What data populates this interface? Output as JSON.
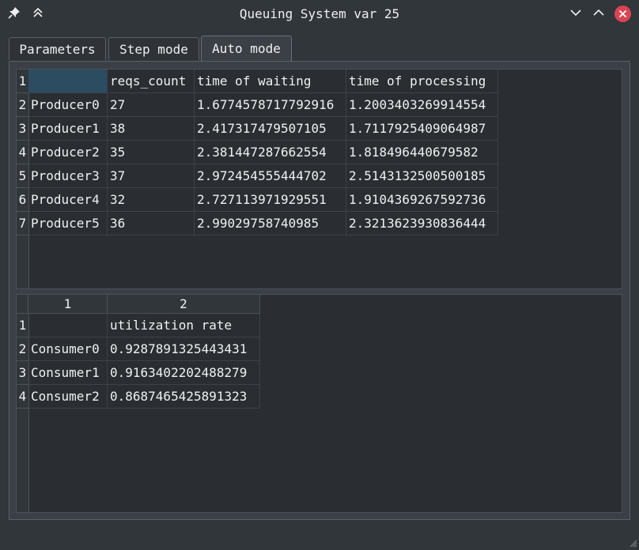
{
  "window": {
    "title": "Queuing System var 25",
    "pin_icon": "pin-icon",
    "keep_above_icon": "double-chevron-up-icon",
    "minimize_icon": "chevron-down-icon",
    "maximize_icon": "chevron-up-icon",
    "close_icon": "close-icon",
    "close_color": "#da4453"
  },
  "tabs": [
    {
      "label": "Parameters",
      "active": false
    },
    {
      "label": "Step mode",
      "active": false
    },
    {
      "label": "Auto mode",
      "active": true
    }
  ],
  "producers_table": {
    "row_numbers": [
      "1",
      "2",
      "3",
      "4",
      "5",
      "6",
      "7"
    ],
    "header_row": [
      "",
      "reqs_count",
      "time of waiting",
      "time of processing"
    ],
    "rows": [
      [
        "Producer0",
        "27",
        "1.6774578717792916",
        "1.2003403269914554"
      ],
      [
        "Producer1",
        "38",
        "2.417317479507105",
        "1.7117925409064987"
      ],
      [
        "Producer2",
        "35",
        "2.381447287662554",
        "1.818496440679582"
      ],
      [
        "Producer3",
        "37",
        "2.972454555444702",
        "2.5143132500500185"
      ],
      [
        "Producer4",
        "32",
        "2.727113971929551",
        "1.9104369267592736"
      ],
      [
        "Producer5",
        "36",
        "2.99029758740985",
        "2.3213623930836444"
      ]
    ]
  },
  "consumers_table": {
    "column_headers": [
      "1",
      "2"
    ],
    "row_numbers": [
      "1",
      "2",
      "3",
      "4"
    ],
    "header_row": [
      "",
      "utilization rate"
    ],
    "rows": [
      [
        "Consumer0",
        "0.9287891325443431"
      ],
      [
        "Consumer1",
        "0.9163402202488279"
      ],
      [
        "Consumer2",
        "0.8687465425891323"
      ]
    ]
  }
}
